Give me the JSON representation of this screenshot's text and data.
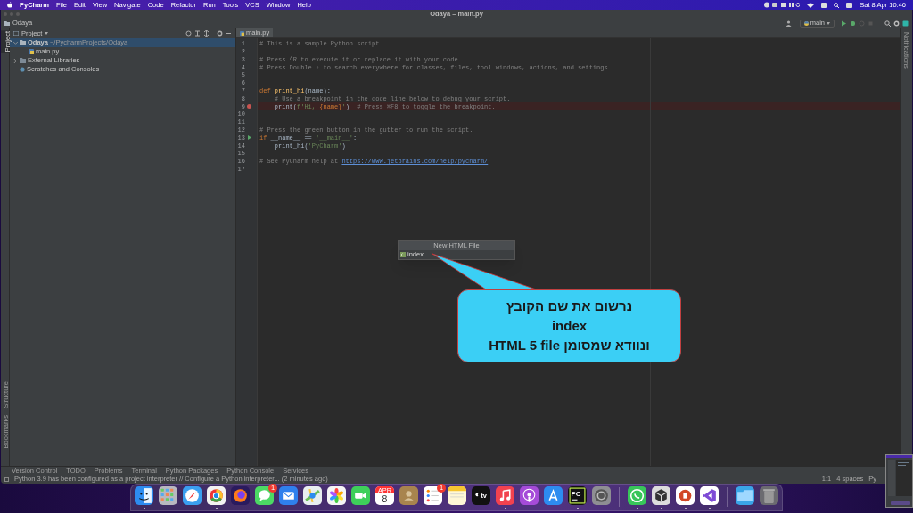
{
  "menu_bar": {
    "app": "PyCharm",
    "items": [
      "File",
      "Edit",
      "View",
      "Navigate",
      "Code",
      "Refactor",
      "Run",
      "Tools",
      "VCS",
      "Window",
      "Help"
    ],
    "clock": "Sat 8 Apr 10:46"
  },
  "window": {
    "title": "Odaya – main.py"
  },
  "breadcrumb": "Odaya",
  "toolbar": {
    "run_config": "main"
  },
  "left_stripe": [
    {
      "label": "Project",
      "selected": true
    },
    {
      "label": "Structure",
      "selected": false
    },
    {
      "label": "Bookmarks",
      "selected": false
    }
  ],
  "project_panel": {
    "title": "Project",
    "tree": [
      {
        "label": "Odaya",
        "path": "~/PycharmProjects/Odaya",
        "kind": "folder",
        "expanded": true,
        "selected": true,
        "children": [
          {
            "label": "main.py",
            "kind": "python",
            "selected": false
          }
        ]
      },
      {
        "label": "External Libraries",
        "kind": "library",
        "expanded": false,
        "selected": false
      },
      {
        "label": "Scratches and Consoles",
        "kind": "scratch",
        "selected": false
      }
    ]
  },
  "editor": {
    "tabs": [
      {
        "label": "main.py",
        "selected": true
      }
    ],
    "lines": [
      {
        "number": "1",
        "breakpoint": false,
        "run_marker": false,
        "tokens": [
          {
            "kind": "comment",
            "text": "# This is a sample Python script."
          }
        ]
      },
      {
        "number": "2",
        "breakpoint": false,
        "run_marker": false
      },
      {
        "number": "3",
        "breakpoint": false,
        "run_marker": false,
        "tokens": [
          {
            "kind": "comment",
            "text": "# Press ^R to execute it or replace it with your code."
          }
        ]
      },
      {
        "number": "4",
        "breakpoint": false,
        "run_marker": false,
        "tokens": [
          {
            "kind": "comment",
            "text": "# Press Double ⇧ to search everywhere for classes, files, tool windows, actions, and settings."
          }
        ]
      },
      {
        "number": "5",
        "breakpoint": false,
        "run_marker": false
      },
      {
        "number": "6",
        "breakpoint": false,
        "run_marker": false
      },
      {
        "number": "7",
        "breakpoint": false,
        "run_marker": false,
        "tokens": [
          {
            "kind": "keyword",
            "text": "def "
          },
          {
            "kind": "function",
            "text": "print_hi"
          },
          {
            "kind": "text",
            "text": "(name):"
          }
        ]
      },
      {
        "number": "8",
        "breakpoint": false,
        "run_marker": false,
        "tokens": [
          {
            "kind": "comment",
            "text": "    # Use a breakpoint in the code line below to debug your script."
          }
        ]
      },
      {
        "number": "9",
        "breakpoint": true,
        "run_marker": false,
        "tokens": [
          {
            "kind": "text",
            "text": "    print("
          },
          {
            "kind": "string",
            "text": "f'Hi, "
          },
          {
            "kind": "keyword",
            "text": "{name}"
          },
          {
            "kind": "string",
            "text": "'"
          },
          {
            "kind": "text",
            "text": ")  "
          },
          {
            "kind": "comment",
            "text": "# Press ⌘F8 to toggle the breakpoint."
          }
        ]
      },
      {
        "number": "10",
        "breakpoint": false,
        "run_marker": false
      },
      {
        "number": "11",
        "breakpoint": false,
        "run_marker": false
      },
      {
        "number": "12",
        "breakpoint": false,
        "run_marker": false,
        "tokens": [
          {
            "kind": "comment",
            "text": "# Press the green button in the gutter to run the script."
          }
        ]
      },
      {
        "number": "13",
        "breakpoint": false,
        "run_marker": true,
        "tokens": [
          {
            "kind": "keyword",
            "text": "if "
          },
          {
            "kind": "text",
            "text": "__name__ == "
          },
          {
            "kind": "string",
            "text": "'__main__'"
          },
          {
            "kind": "text",
            "text": ":"
          }
        ]
      },
      {
        "number": "14",
        "breakpoint": false,
        "run_marker": false,
        "tokens": [
          {
            "kind": "text",
            "text": "    print_hi("
          },
          {
            "kind": "string",
            "text": "'PyCharm'"
          },
          {
            "kind": "text",
            "text": ")"
          }
        ]
      },
      {
        "number": "15",
        "breakpoint": false,
        "run_marker": false
      },
      {
        "number": "16",
        "breakpoint": false,
        "run_marker": false,
        "tokens": [
          {
            "kind": "comment",
            "text": "# See PyCharm help at "
          },
          {
            "kind": "link",
            "text": "https://www.jetbrains.com/help/pycharm/"
          }
        ]
      },
      {
        "number": "17",
        "breakpoint": false,
        "run_marker": false
      }
    ]
  },
  "popup": {
    "title": "New HTML File",
    "value": "index"
  },
  "callout": {
    "lines": [
      "נרשום את שם הקובץ",
      "index",
      "ונוודא שמסומן HTML 5 file"
    ]
  },
  "right_stripe": [
    "Notifications"
  ],
  "tool_tabs": [
    "Version Control",
    "TODO",
    "Problems",
    "Terminal",
    "Python Packages",
    "Python Console",
    "Services"
  ],
  "status_bar": {
    "message": "Python 3.9 has been configured as a project interpreter // Configure a Python interpreter... (2 minutes ago)",
    "position": "1:1",
    "indent": "4 spaces",
    "interpreter": "Py"
  },
  "dock": {
    "items": [
      {
        "kind": "face",
        "color": "#2d8cf0",
        "running": true
      },
      {
        "kind": "grid",
        "color": "#b8b8c0",
        "running": false
      },
      {
        "kind": "compass",
        "color": "#3a9ff0",
        "running": false
      },
      {
        "kind": "rings",
        "color": "#f2f2f2",
        "running": true
      },
      {
        "kind": "fox",
        "color": "#2a1a5e",
        "running": false
      },
      {
        "kind": "bubble",
        "color": "#4cd964",
        "running": false,
        "badge": "1"
      },
      {
        "kind": "envelope",
        "color": "#2f80ed",
        "running": false
      },
      {
        "kind": "map",
        "color": "#e8eef0",
        "running": false
      },
      {
        "kind": "flower",
        "color": "#f5f5f5",
        "running": false
      },
      {
        "kind": "camera",
        "color": "#3ecf5a",
        "running": false
      },
      {
        "kind": "calendar",
        "color": "#ffffff",
        "running": false,
        "month": "APR",
        "day": "8"
      },
      {
        "kind": "contact",
        "color": "#a8844e",
        "running": false
      },
      {
        "kind": "list",
        "color": "#ffffff",
        "running": false,
        "badge": "1"
      },
      {
        "kind": "notes",
        "color": "#fff7d6",
        "running": false
      },
      {
        "kind": "tv",
        "color": "#111111",
        "running": false,
        "label": "tv"
      },
      {
        "kind": "note",
        "color": "#f2424f",
        "running": true
      },
      {
        "kind": "podcast",
        "color": "#a54bd8",
        "running": false
      },
      {
        "kind": "store",
        "color": "#2d8cf0",
        "running": false
      },
      {
        "kind": "ide",
        "color": "#111111",
        "running": true,
        "label": "PC"
      },
      {
        "kind": "gear",
        "color": "#8e8e93",
        "running": false
      },
      {
        "kind": "separator"
      },
      {
        "kind": "phone",
        "color": "#38c55a",
        "running": true
      },
      {
        "kind": "cube",
        "color": "#dddddd",
        "running": true
      },
      {
        "kind": "slides",
        "color": "#ffffff",
        "running": true
      },
      {
        "kind": "vs",
        "color": "#ffffff",
        "running": true
      },
      {
        "kind": "separator"
      },
      {
        "kind": "folder",
        "color": "#3aa5e8",
        "running": false
      },
      {
        "kind": "trash",
        "color": "#6b6b70",
        "running": false
      }
    ]
  }
}
